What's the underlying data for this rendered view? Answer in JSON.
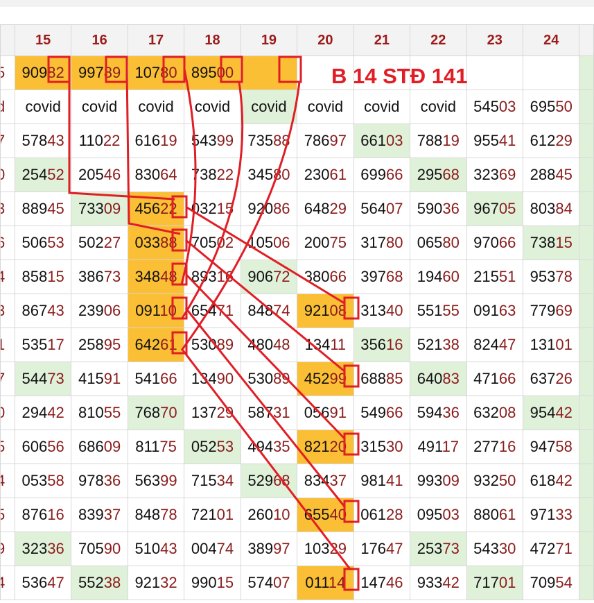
{
  "columns": [
    "",
    "15",
    "16",
    "17",
    "18",
    "19",
    "20",
    "21",
    "22",
    "23",
    "24",
    ""
  ],
  "annotation": "B 14 STĐ 141",
  "colors": {
    "orange": "#fbbf35",
    "green": "#e0f1da",
    "red": "#e01e25",
    "header_text": "#9b1b1b"
  },
  "rows": [
    [
      "5",
      "90982",
      "99789",
      "10780",
      "89500",
      "",
      "",
      "",
      "",
      "",
      "",
      ""
    ],
    [
      "d",
      "covid",
      "covid",
      "covid",
      "covid",
      "covid",
      "covid",
      "covid",
      "covid",
      "54503",
      "69550",
      ""
    ],
    [
      "7",
      "57843",
      "11022",
      "61619",
      "54399",
      "73588",
      "78697",
      "66103",
      "78819",
      "95541",
      "61229",
      ""
    ],
    [
      "0",
      "25452",
      "20546",
      "83064",
      "73822",
      "34580",
      "23061",
      "69966",
      "29568",
      "32369",
      "28845",
      ""
    ],
    [
      "3",
      "88945",
      "73309",
      "45622",
      "03215",
      "92086",
      "64829",
      "56407",
      "59036",
      "96705",
      "80384",
      ""
    ],
    [
      "6",
      "50653",
      "50227",
      "03388",
      "70502",
      "10506",
      "20075",
      "31780",
      "06580",
      "97066",
      "73815",
      ""
    ],
    [
      "4",
      "85815",
      "38673",
      "34848",
      "89316",
      "90672",
      "38066",
      "39768",
      "19460",
      "21551",
      "95378",
      ""
    ],
    [
      "3",
      "86743",
      "23906",
      "09110",
      "65471",
      "84874",
      "92108",
      "31340",
      "55155",
      "09163",
      "77969",
      ""
    ],
    [
      "1",
      "53517",
      "25895",
      "64261",
      "53089",
      "48048",
      "13411",
      "35616",
      "52138",
      "82447",
      "13101",
      ""
    ],
    [
      "7",
      "54473",
      "41591",
      "54166",
      "13490",
      "53089",
      "45299",
      "68885",
      "64083",
      "47166",
      "63726",
      ""
    ],
    [
      "0",
      "29442",
      "81055",
      "76870",
      "13729",
      "58731",
      "05691",
      "54966",
      "59436",
      "63208",
      "95442",
      ""
    ],
    [
      "5",
      "60656",
      "68609",
      "81175",
      "05253",
      "49435",
      "82120",
      "31530",
      "49117",
      "27716",
      "94758",
      ""
    ],
    [
      "4",
      "05358",
      "97836",
      "56399",
      "71534",
      "52968",
      "83437",
      "98141",
      "99309",
      "93250",
      "61842",
      ""
    ],
    [
      "5",
      "87616",
      "83937",
      "84878",
      "72101",
      "26010",
      "65540",
      "06128",
      "09503",
      "88061",
      "97133",
      ""
    ],
    [
      "9",
      "32336",
      "70590",
      "51043",
      "00474",
      "38997",
      "10329",
      "17647",
      "25373",
      "54330",
      "47271",
      ""
    ],
    [
      "4",
      "53647",
      "55238",
      "92132",
      "99015",
      "57407",
      "01114",
      "14746",
      "93342",
      "71701",
      "70954",
      ""
    ]
  ],
  "shading": [
    [
      "w",
      "o",
      "o",
      "o",
      "o",
      "o",
      "w",
      "w",
      "w",
      "w",
      "w",
      "g"
    ],
    [
      "w",
      "w",
      "w",
      "w",
      "w",
      "g",
      "w",
      "w",
      "w",
      "w",
      "w",
      "g"
    ],
    [
      "w",
      "w",
      "w",
      "w",
      "w",
      "w",
      "w",
      "g",
      "w",
      "w",
      "w",
      "g"
    ],
    [
      "w",
      "g",
      "w",
      "w",
      "w",
      "w",
      "w",
      "w",
      "g",
      "w",
      "w",
      "g"
    ],
    [
      "w",
      "w",
      "g",
      "o",
      "w",
      "w",
      "w",
      "w",
      "w",
      "g",
      "w",
      "g"
    ],
    [
      "w",
      "w",
      "w",
      "o",
      "w",
      "w",
      "w",
      "w",
      "w",
      "w",
      "g",
      "g"
    ],
    [
      "w",
      "w",
      "w",
      "o",
      "w",
      "g",
      "w",
      "w",
      "w",
      "w",
      "w",
      "g"
    ],
    [
      "w",
      "w",
      "w",
      "o",
      "w",
      "w",
      "o",
      "w",
      "w",
      "w",
      "w",
      "g"
    ],
    [
      "w",
      "w",
      "w",
      "o",
      "w",
      "w",
      "w",
      "g",
      "w",
      "w",
      "w",
      "g"
    ],
    [
      "w",
      "g",
      "w",
      "w",
      "w",
      "w",
      "o",
      "w",
      "g",
      "w",
      "w",
      "g"
    ],
    [
      "w",
      "w",
      "w",
      "g",
      "w",
      "w",
      "w",
      "w",
      "w",
      "w",
      "g",
      "g"
    ],
    [
      "w",
      "w",
      "w",
      "w",
      "g",
      "w",
      "o",
      "w",
      "w",
      "w",
      "w",
      "g"
    ],
    [
      "w",
      "w",
      "w",
      "w",
      "w",
      "g",
      "w",
      "w",
      "w",
      "w",
      "w",
      "g"
    ],
    [
      "w",
      "w",
      "w",
      "w",
      "w",
      "w",
      "o",
      "w",
      "w",
      "w",
      "w",
      "g"
    ],
    [
      "w",
      "g",
      "w",
      "w",
      "w",
      "w",
      "w",
      "w",
      "g",
      "w",
      "w",
      "g"
    ],
    [
      "w",
      "w",
      "g",
      "w",
      "w",
      "w",
      "o",
      "w",
      "w",
      "g",
      "w",
      "g"
    ]
  ]
}
